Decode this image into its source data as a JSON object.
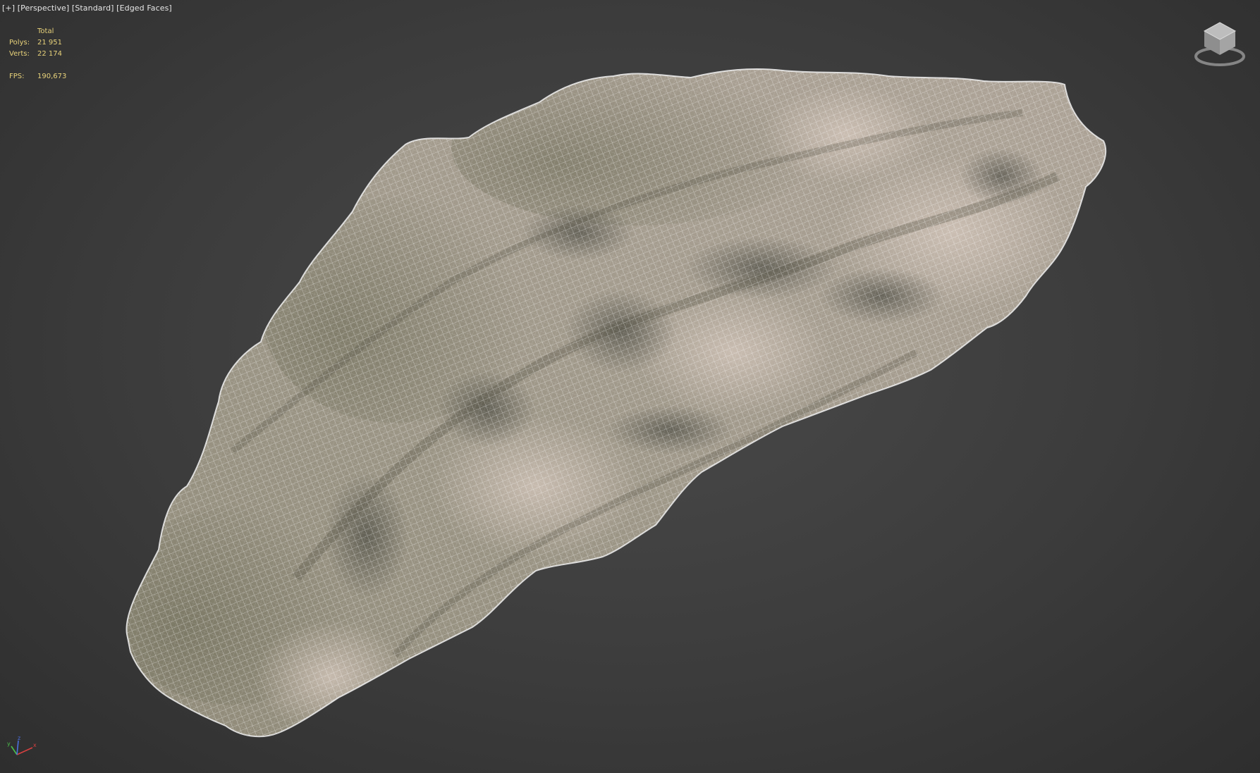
{
  "viewport": {
    "plus_menu": "[+]",
    "view_menu": "[Perspective]",
    "shading_menu": "[Standard]",
    "display_menu": "[Edged Faces]"
  },
  "stats": {
    "header": "Total",
    "polys_label": "Polys:",
    "polys_value": "21 951",
    "verts_label": "Verts:",
    "verts_value": "22 174",
    "fps_label": "FPS:",
    "fps_value": "190,673"
  },
  "icons": {
    "viewcube": "viewcube-icon",
    "axis_tripod": "axis-tripod-icon"
  },
  "colors": {
    "stats_text": "#e8d27a",
    "label_text": "#e6e6e6",
    "background": "#3c3c3c",
    "wire": "#ffffff"
  }
}
